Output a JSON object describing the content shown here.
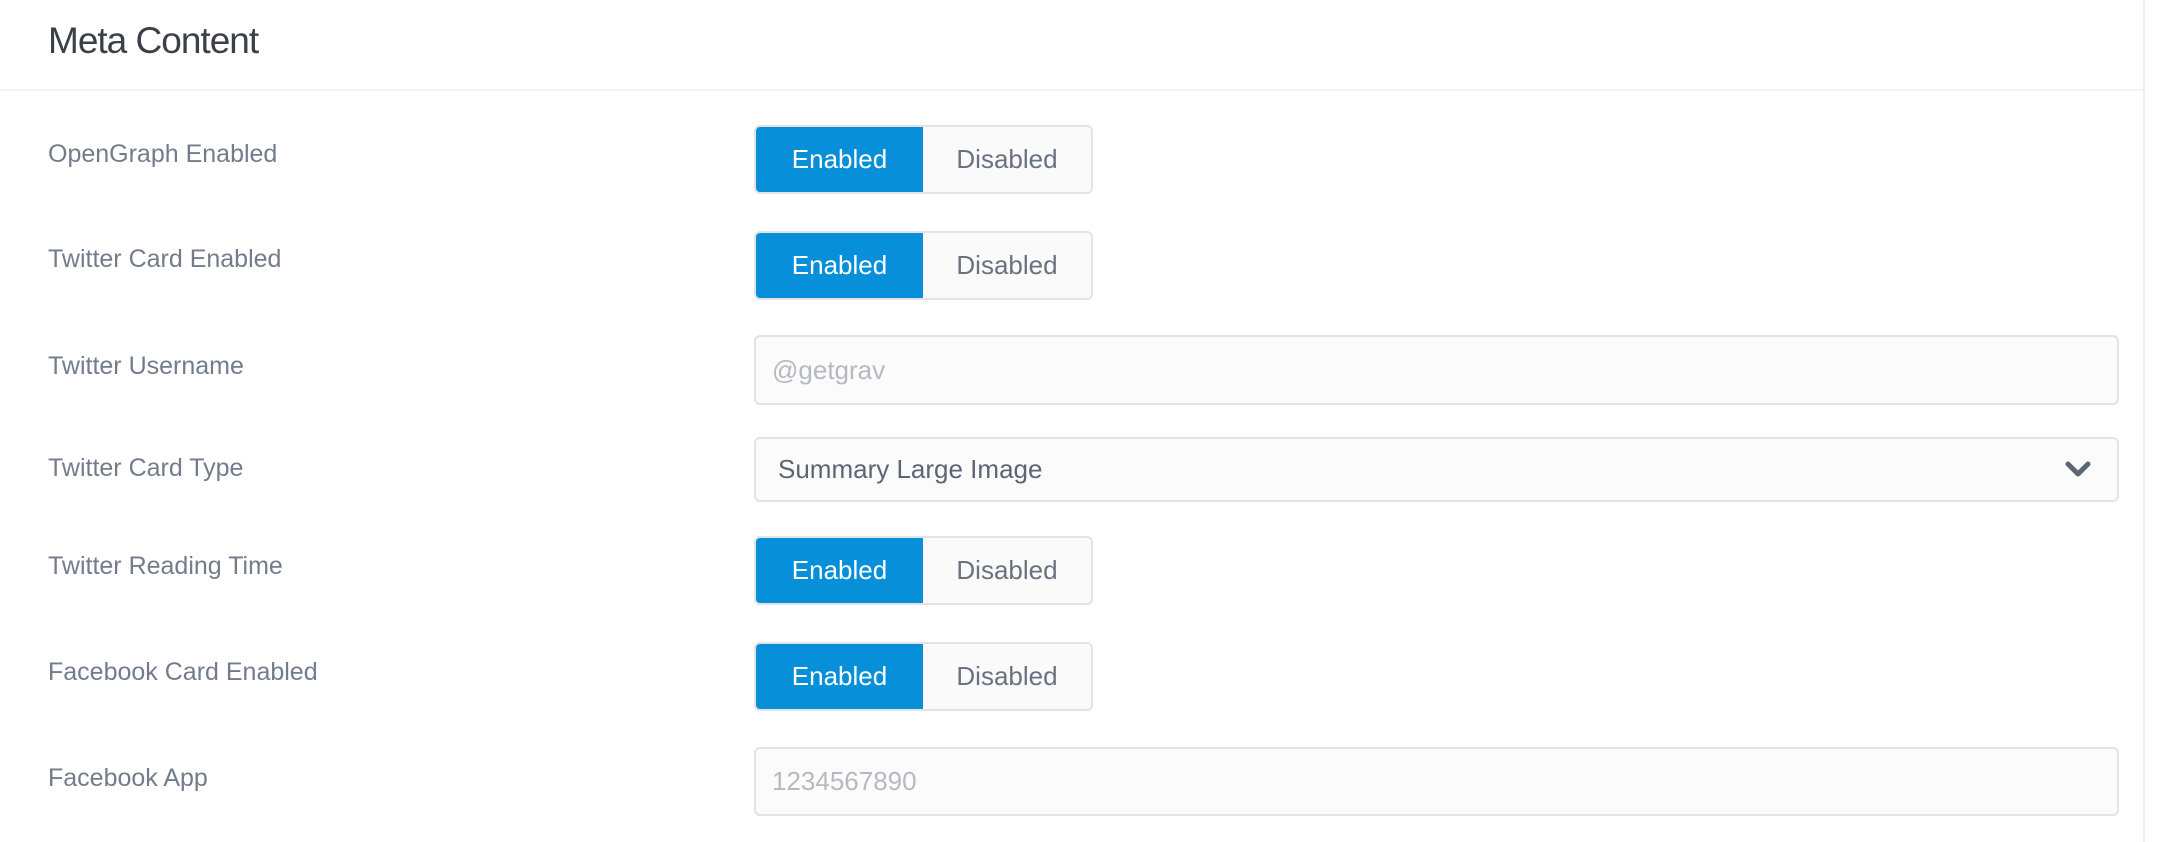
{
  "header": {
    "title": "Meta Content"
  },
  "accent_color": "#0790d9",
  "fields": [
    {
      "label": "OpenGraph Enabled",
      "type": "toggle",
      "options": [
        "Enabled",
        "Disabled"
      ],
      "selected": "Enabled"
    },
    {
      "label": "Twitter Card Enabled",
      "type": "toggle",
      "options": [
        "Enabled",
        "Disabled"
      ],
      "selected": "Enabled"
    },
    {
      "label": "Twitter Username",
      "type": "text",
      "placeholder": "@getgrav",
      "value": ""
    },
    {
      "label": "Twitter Card Type",
      "type": "select",
      "value": "Summary Large Image",
      "icon": "chevron-down-icon"
    },
    {
      "label": "Twitter Reading Time",
      "type": "toggle",
      "options": [
        "Enabled",
        "Disabled"
      ],
      "selected": "Enabled"
    },
    {
      "label": "Facebook Card Enabled",
      "type": "toggle",
      "options": [
        "Enabled",
        "Disabled"
      ],
      "selected": "Enabled"
    },
    {
      "label": "Facebook App",
      "type": "text",
      "placeholder": "1234567890",
      "value": ""
    }
  ]
}
